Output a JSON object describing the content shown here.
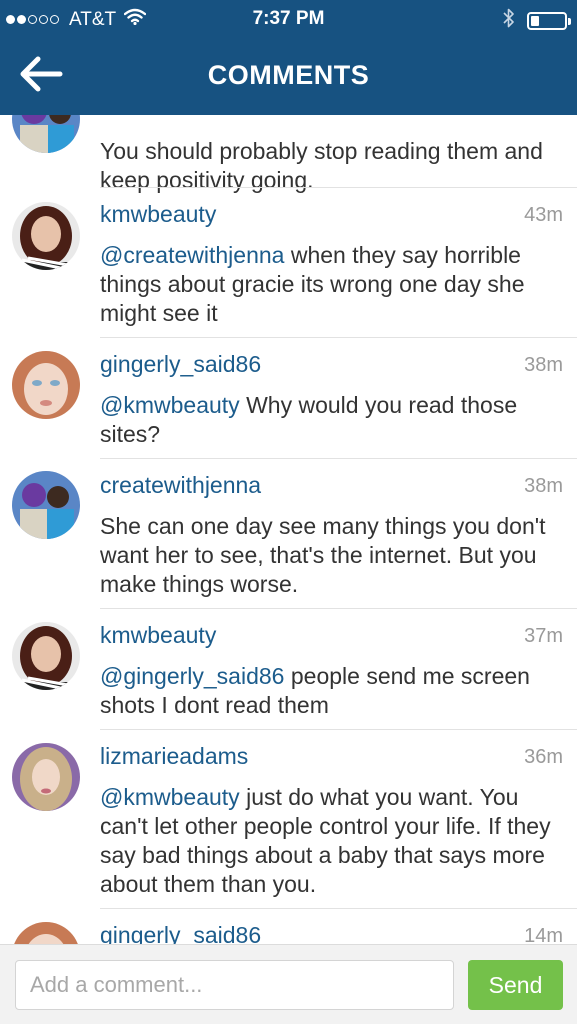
{
  "status_bar": {
    "carrier": "AT&T",
    "time": "7:37 PM",
    "signal_bars_filled": 2,
    "signal_bars_total": 5,
    "battery_level": 0.25
  },
  "header": {
    "title": "COMMENTS",
    "back_icon": "back-arrow-icon",
    "background_color": "#175281"
  },
  "comments": [
    {
      "username": "",
      "time": "",
      "mention": "",
      "text": "You should probably stop reading them and keep positivity going."
    },
    {
      "username": "kmwbeauty",
      "time": "43m",
      "mention": "@createwithjenna",
      "text": " when they say horrible things about gracie its wrong one day she might see it"
    },
    {
      "username": "gingerly_said86",
      "time": "38m",
      "mention": "@kmwbeauty",
      "text": " Why would you read those sites?"
    },
    {
      "username": "createwithjenna",
      "time": "38m",
      "mention": "",
      "text": "She can one day see many things you don't want her to see, that's the internet. But you make things worse."
    },
    {
      "username": "kmwbeauty",
      "time": "37m",
      "mention": "@gingerly_said86",
      "text": " people send me screen shots I dont read them"
    },
    {
      "username": "lizmarieadams",
      "time": "36m",
      "mention": "@kmwbeauty",
      "text": " just do what you want. You can't let other people control your life. If they say bad things about a baby that says more about them than you."
    },
    {
      "username": "gingerly_said86",
      "time": "14m",
      "mention": "",
      "text": ""
    }
  ],
  "compose": {
    "placeholder": "Add a comment...",
    "send_label": "Send",
    "send_color": "#74c14a"
  },
  "colors": {
    "link": "#1c5c8c",
    "timestamp": "#9a9a9a",
    "body_text": "#333333"
  }
}
